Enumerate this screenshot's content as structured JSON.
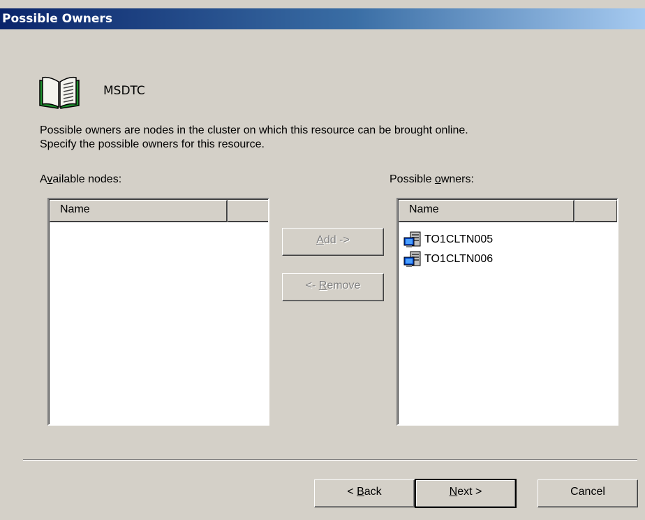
{
  "window": {
    "title": "Possible Owners"
  },
  "resource": {
    "name": "MSDTC",
    "icon": "open-book-icon"
  },
  "description": {
    "line1": "Possible owners are nodes in the cluster on which this resource can be brought online.",
    "line2": "Specify the possible owners for this resource."
  },
  "available": {
    "label_pre": "A",
    "label_key": "v",
    "label_post": "ailable nodes:",
    "column": "Name",
    "items": []
  },
  "owners": {
    "label_pre": "Possible ",
    "label_key": "o",
    "label_post": "wners:",
    "column": "Name",
    "items": [
      {
        "name": "TO1CLTN005",
        "icon": "cluster-node-icon"
      },
      {
        "name": "TO1CLTN006",
        "icon": "cluster-node-icon"
      }
    ]
  },
  "buttons": {
    "add": {
      "key": "A",
      "rest": "dd ->"
    },
    "remove": {
      "pre": "<- ",
      "key": "R",
      "rest": "emove"
    },
    "back": {
      "pre": "< ",
      "key": "B",
      "rest": "ack"
    },
    "next": {
      "key": "N",
      "rest": "ext >"
    },
    "cancel": "Cancel"
  }
}
